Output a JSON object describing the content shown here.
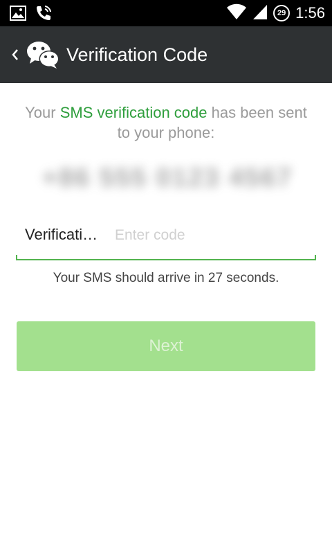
{
  "status_bar": {
    "time": "1:56",
    "badge": "29",
    "icons": [
      "image-icon",
      "call-icon",
      "wifi-icon",
      "signal-icon"
    ]
  },
  "app_bar": {
    "title": "Verification Code",
    "back_icon": "chevron-left-icon",
    "logo_icon": "wechat-logo-icon"
  },
  "intro": {
    "prefix": "Your ",
    "highlight": "SMS verification code",
    "suffix": " has been sent to your phone:"
  },
  "phone_number_redacted": "+86 555 0123 4567",
  "code_field": {
    "label": "Verification Code",
    "placeholder": "Enter code",
    "value": ""
  },
  "sms_note": "Your SMS should arrive in 27 seconds.",
  "next_button": {
    "label": "Next"
  },
  "colors": {
    "app_bar": "#2e3133",
    "accent_green": "#2e9e3c",
    "button_disabled": "#a3e08e",
    "field_underline": "#53b44f"
  }
}
